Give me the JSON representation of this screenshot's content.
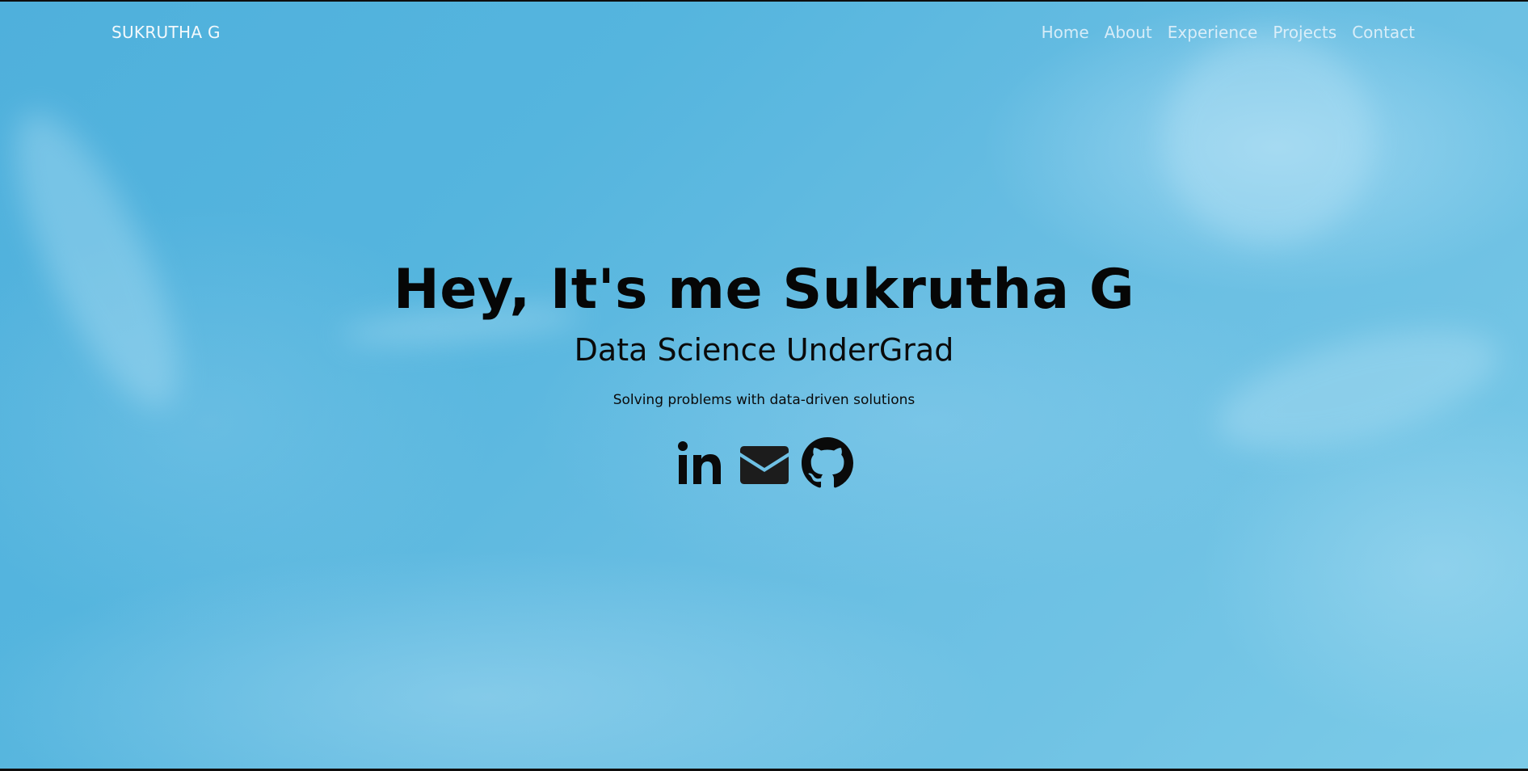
{
  "navbar": {
    "brand": "SUKRUTHA G",
    "links": [
      "Home",
      "About",
      "Experience",
      "Projects",
      "Contact"
    ]
  },
  "hero": {
    "title": "Hey, It's me Sukrutha G",
    "subtitle": "Data Science UnderGrad",
    "tagline": "Solving problems with data-driven solutions"
  },
  "socials": [
    {
      "icon": "linkedin-icon"
    },
    {
      "icon": "envelope-icon"
    },
    {
      "icon": "github-icon"
    }
  ],
  "colors": {
    "background": "#5ab8e0",
    "nav_text": "#f4f9fc",
    "hero_text": "#060606"
  }
}
